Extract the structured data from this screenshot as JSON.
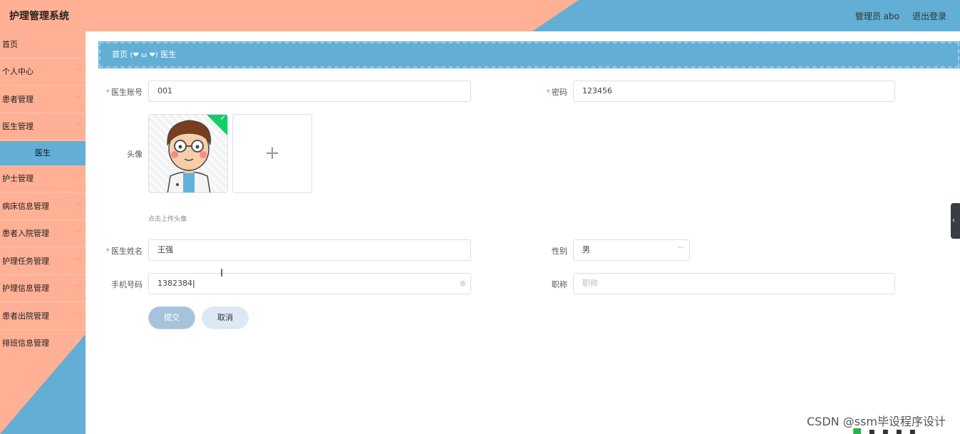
{
  "header": {
    "title": "护理管理系统",
    "user": "管理员 abo",
    "logout": "退出登录"
  },
  "sidebar": {
    "items": [
      {
        "label": "首页",
        "has_arrow": false
      },
      {
        "label": "个人中心",
        "has_arrow": true
      },
      {
        "label": "患者管理",
        "has_arrow": true
      },
      {
        "label": "医生管理",
        "has_arrow": true
      },
      {
        "label": "医生",
        "has_arrow": false,
        "active": true
      },
      {
        "label": "护士管理",
        "has_arrow": true
      },
      {
        "label": "病床信息管理",
        "has_arrow": true
      },
      {
        "label": "患者入院管理",
        "has_arrow": true
      },
      {
        "label": "护理任务管理",
        "has_arrow": true
      },
      {
        "label": "护理信息管理",
        "has_arrow": true
      },
      {
        "label": "患者出院管理",
        "has_arrow": true
      },
      {
        "label": "排班信息管理",
        "has_arrow": true
      }
    ]
  },
  "breadcrumb": {
    "home": "首页",
    "separator": "(❤ ω ❤)",
    "current": "医生"
  },
  "form": {
    "account_label": "医生账号",
    "account_value": "001",
    "password_label": "密码",
    "password_value": "123456",
    "avatar_label": "头像",
    "avatar_hint": "点击上传头像",
    "name_label": "医生姓名",
    "name_value": "王强",
    "gender_label": "性别",
    "gender_value": "男",
    "phone_label": "手机号码",
    "phone_value": "1382384",
    "title_label": "职称",
    "title_placeholder": "职称",
    "submit": "提交",
    "cancel": "取消"
  },
  "watermark": "CSDN @ssm毕设程序设计",
  "colors": {
    "salmon": "#ffb095",
    "blue": "#62aed5",
    "required": "#f56c6c"
  }
}
